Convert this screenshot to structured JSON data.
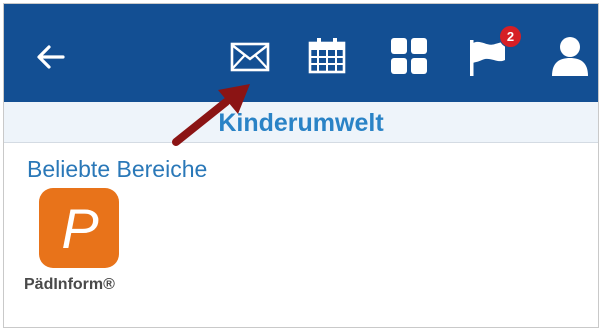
{
  "header": {
    "back_icon": "arrow-left-icon",
    "icons": [
      "envelope-icon",
      "calendar-icon",
      "grid-icon",
      "flag-icon",
      "user-icon"
    ],
    "notification_count": "2",
    "colors": {
      "bar": "#134f93",
      "badge": "#d61f26"
    }
  },
  "subheader": {
    "title": "Kinderumwelt"
  },
  "favorites": {
    "title": "Beliebte Bereiche",
    "items": [
      {
        "label": "PädInform®",
        "icon_letter": "P",
        "tile_color": "#e8731a"
      }
    ]
  },
  "annotation": {
    "icon": "pointer-arrow-icon",
    "color": "#8b1414"
  }
}
